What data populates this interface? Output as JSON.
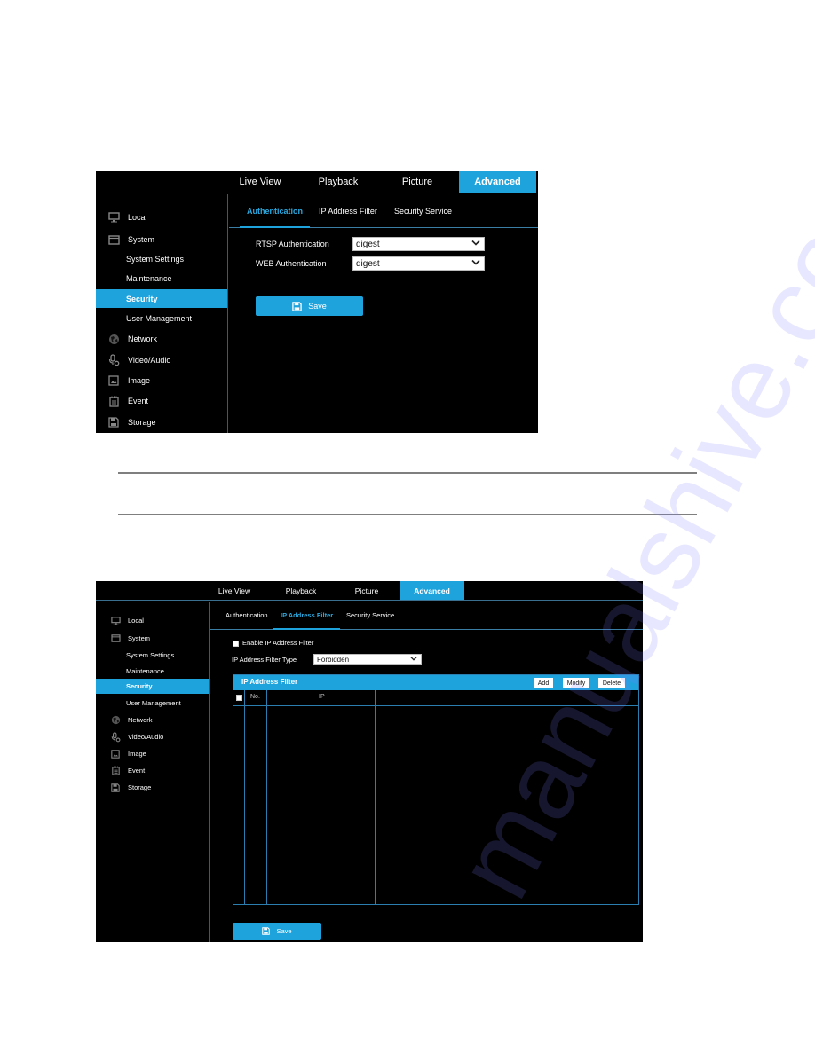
{
  "colors": {
    "accent": "#1fa3dd",
    "background": "#000000",
    "divider": "#7f7f7f"
  },
  "screenshot1": {
    "top_nav": {
      "tabs": [
        {
          "label": "Live View",
          "active": false
        },
        {
          "label": "Playback",
          "active": false
        },
        {
          "label": "Picture",
          "active": false
        },
        {
          "label": "Advanced",
          "active": true
        }
      ]
    },
    "sidebar": {
      "items": [
        {
          "label": "Local",
          "icon": "monitor-icon",
          "level": 1
        },
        {
          "label": "System",
          "icon": "window-icon",
          "level": 1
        },
        {
          "label": "System Settings",
          "level": 2
        },
        {
          "label": "Maintenance",
          "level": 2
        },
        {
          "label": "Security",
          "level": 2,
          "active": true
        },
        {
          "label": "User Management",
          "level": 2
        },
        {
          "label": "Network",
          "icon": "globe-icon",
          "level": 1
        },
        {
          "label": "Video/Audio",
          "icon": "microphone-gear-icon",
          "level": 1
        },
        {
          "label": "Image",
          "icon": "image-icon",
          "level": 1
        },
        {
          "label": "Event",
          "icon": "calendar-icon",
          "level": 1
        },
        {
          "label": "Storage",
          "icon": "floppy-icon",
          "level": 1
        }
      ]
    },
    "sub_tabs": [
      {
        "label": "Authentication",
        "active": true
      },
      {
        "label": "IP Address Filter",
        "active": false
      },
      {
        "label": "Security Service",
        "active": false
      }
    ],
    "form": {
      "rtsp_auth_label": "RTSP Authentication",
      "rtsp_auth_value": "digest",
      "web_auth_label": "WEB Authentication",
      "web_auth_value": "digest"
    },
    "save_label": "Save"
  },
  "screenshot2": {
    "top_nav": {
      "tabs": [
        {
          "label": "Live View",
          "active": false
        },
        {
          "label": "Playback",
          "active": false
        },
        {
          "label": "Picture",
          "active": false
        },
        {
          "label": "Advanced",
          "active": true
        }
      ]
    },
    "sidebar": {
      "items": [
        {
          "label": "Local",
          "icon": "monitor-icon",
          "level": 1
        },
        {
          "label": "System",
          "icon": "window-icon",
          "level": 1
        },
        {
          "label": "System Settings",
          "level": 2
        },
        {
          "label": "Maintenance",
          "level": 2
        },
        {
          "label": "Security",
          "level": 2,
          "active": true
        },
        {
          "label": "User Management",
          "level": 2
        },
        {
          "label": "Network",
          "icon": "globe-icon",
          "level": 1
        },
        {
          "label": "Video/Audio",
          "icon": "microphone-gear-icon",
          "level": 1
        },
        {
          "label": "Image",
          "icon": "image-icon",
          "level": 1
        },
        {
          "label": "Event",
          "icon": "calendar-icon",
          "level": 1
        },
        {
          "label": "Storage",
          "icon": "floppy-icon",
          "level": 1
        }
      ]
    },
    "sub_tabs": [
      {
        "label": "Authentication",
        "active": false
      },
      {
        "label": "IP Address Filter",
        "active": true
      },
      {
        "label": "Security Service",
        "active": false
      }
    ],
    "form": {
      "enable_label": "Enable IP Address Filter",
      "enable_checked": false,
      "filter_type_label": "IP Address Filter Type",
      "filter_type_value": "Forbidden"
    },
    "table": {
      "title": "IP Address Filter",
      "buttons": {
        "add": "Add",
        "modify": "Modify",
        "delete": "Delete"
      },
      "columns": [
        "No.",
        "IP"
      ],
      "rows": []
    },
    "save_label": "Save"
  },
  "watermark": "manualshive.com"
}
